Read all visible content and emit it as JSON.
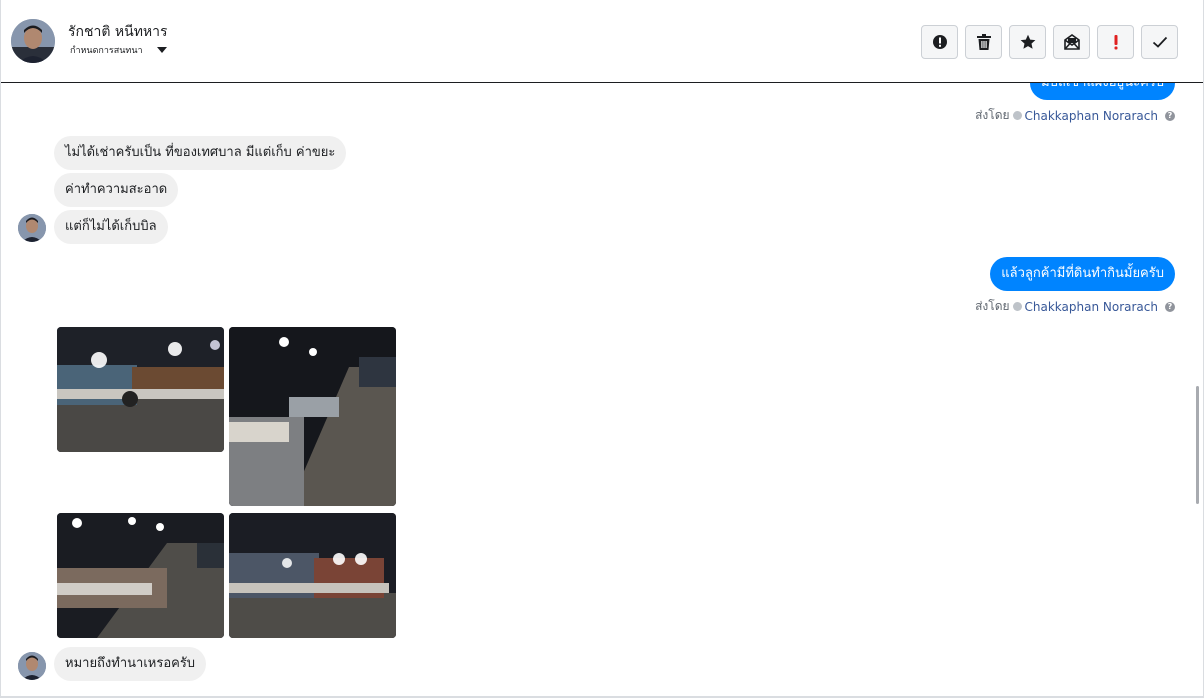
{
  "header": {
    "contact_name": "รักชาติ หนีทหาร",
    "assign_label": "กำหนดการสนทนา"
  },
  "toolbar": [
    {
      "icon": "alert-circle-icon",
      "name": "mark-spam-button"
    },
    {
      "icon": "trash-icon",
      "name": "delete-button"
    },
    {
      "icon": "star-icon",
      "name": "star-button"
    },
    {
      "icon": "mail-open-icon",
      "name": "mark-unread-button"
    },
    {
      "icon": "exclamation-icon",
      "name": "follow-up-button"
    },
    {
      "icon": "check-icon",
      "name": "mark-done-button"
    }
  ],
  "messages": {
    "out_top_partial": "มีบิลเช่าแผงอยู่นะครับ",
    "in_1": "ไม่ได้เช่าครับเป็น ที่ของเทศบาล มีแต่เก็บ ค่าขยะ",
    "in_2": "ค่าทำความสะอาด",
    "in_3": "แต่ก็ไม่ได้เก็บบิล",
    "out_1": "แล้วลูกค้ามีที่ดินทำกินมั้ยครับ",
    "in_4": "หมายถึงทำนาเหรอครับ"
  },
  "sent_by": {
    "prefix": "ส่งโดย",
    "sender": "Chakkaphan Norarach"
  },
  "colors": {
    "outgoing_bubble": "#0084ff",
    "incoming_bubble": "#f0f0f0",
    "sender_link": "#385898",
    "follow_up_icon": "#e02020"
  }
}
